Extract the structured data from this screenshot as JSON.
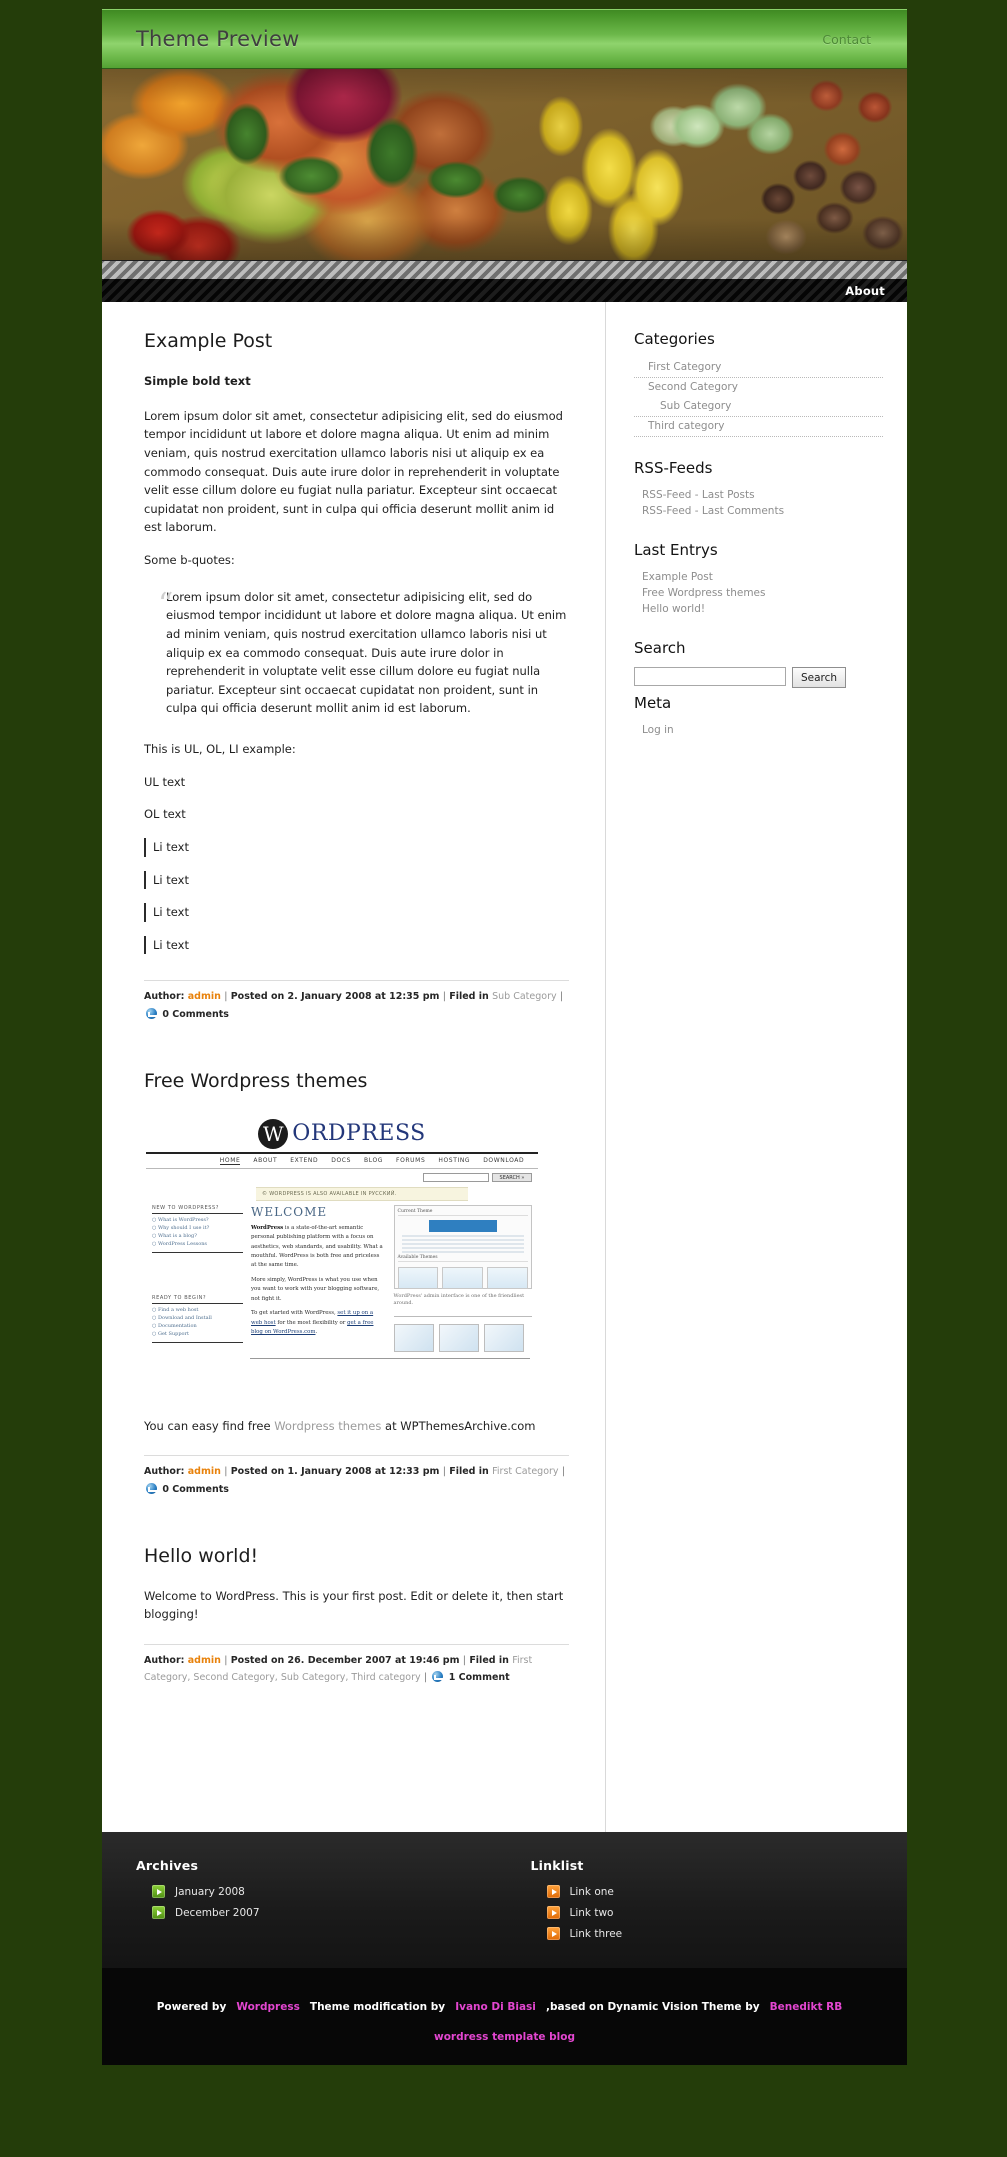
{
  "header": {
    "site_title": "Theme Preview",
    "top_nav": [
      {
        "label": "Contact"
      }
    ],
    "main_nav": [
      {
        "label": "About"
      }
    ]
  },
  "posts": [
    {
      "title": "Example Post",
      "bold_line": "Simple bold text",
      "body": "Lorem ipsum dolor sit amet, consectetur adipisicing elit, sed do eiusmod tempor incididunt ut labore et dolore magna aliqua. Ut enim ad minim veniam, quis nostrud exercitation ullamco laboris nisi ut aliquip ex ea commodo consequat. Duis aute irure dolor in reprehenderit in voluptate velit esse cillum dolore eu fugiat nulla pariatur. Excepteur sint occaecat cupidatat non proident, sunt in culpa qui officia deserunt mollit anim id est laborum.",
      "quote_intro": "Some b-quotes:",
      "quote_mark": "“",
      "quote": "Lorem ipsum dolor sit amet, consectetur adipisicing elit, sed do eiusmod tempor incididunt ut labore et dolore magna aliqua. Ut enim ad minim veniam, quis nostrud exercitation ullamco laboris nisi ut aliquip ex ea commodo consequat. Duis aute irure dolor in reprehenderit in voluptate velit esse cillum dolore eu fugiat nulla pariatur. Excepteur sint occaecat cupidatat non proident, sunt in culpa qui officia deserunt mollit anim id est laborum.",
      "list_intro": "This is UL, OL, LI example:",
      "ul_text": "UL text",
      "ol_text": "OL text",
      "li_items": [
        "Li text",
        "Li text",
        "Li text",
        "Li text"
      ],
      "meta": {
        "author_label": "Author:",
        "author": "admin",
        "posted": "Posted on 2. January 2008 at 12:35 pm",
        "filed_label": "Filed in",
        "categories": "Sub Category",
        "comments": "0 Comments"
      }
    },
    {
      "title": "Free Wordpress themes",
      "caption_pre": "You can easy find free ",
      "caption_link": "Wordpress themes",
      "caption_post": " at WPThemesArchive.com",
      "meta": {
        "author_label": "Author:",
        "author": "admin",
        "posted": "Posted on 1. January 2008 at 12:33 pm",
        "filed_label": "Filed in",
        "categories": "First Category",
        "comments": "0 Comments"
      }
    },
    {
      "title": "Hello world!",
      "body": "Welcome to WordPress. This is your first post. Edit or delete it, then start blogging!",
      "meta": {
        "author_label": "Author:",
        "author": "admin",
        "posted": "Posted on 26. December 2007 at 19:46 pm",
        "filed_label": "Filed in",
        "categories": "First Category, Second Category, Sub Category, Third category",
        "comments": "1 Comment"
      }
    }
  ],
  "wp_screenshot": {
    "brand_mark": "W",
    "brand_word": "ORDPRESS",
    "nav": [
      "HOME",
      "ABOUT",
      "EXTEND",
      "DOCS",
      "BLOG",
      "FORUMS",
      "HOSTING",
      "DOWNLOAD"
    ],
    "search_button": "SEARCH »",
    "notice": "© WORDPRESS IS ALSO AVAILABLE IN РУССКИЙ.",
    "col1_head_a": "NEW TO WORDPRESS?",
    "col1_links_a": [
      "○ What is WordPress?",
      "○ Why should I use it?",
      "○ What is a blog?",
      "○ WordPress Lessons"
    ],
    "col1_head_b": "READY TO BEGIN?",
    "col1_links_b": [
      "○ Find a web host",
      "○ Download and Install",
      "○ Documentation",
      "○ Get Support"
    ],
    "welcome": "WELCOME",
    "para1_lead": "WordPress",
    "para1": " is a state-of-the-art semantic personal publishing platform with a focus on aesthetics, web standards, and usability. What a mouthful. WordPress is both free and priceless at the same time.",
    "para2": "More simply, WordPress is what you use when you want to work with your blogging software, not fight it.",
    "para3_pre": "To get started with WordPress, ",
    "para3_link1": "set it up on a web host",
    "para3_mid": " for the most flexibility or ",
    "para3_link2": "get a free blog on WordPress.com",
    "para3_end": ".",
    "panel_title": "Current Theme",
    "panel_sub": "Available Themes",
    "panel_caption": "WordPress' admin interface is one of the friendliest around."
  },
  "sidebar": {
    "categories": {
      "heading": "Categories",
      "items": [
        {
          "label": "First Category",
          "children": []
        },
        {
          "label": "Second Category",
          "children": [
            {
              "label": "Sub Category"
            }
          ]
        },
        {
          "label": "Third category",
          "children": []
        }
      ]
    },
    "rss": {
      "heading": "RSS-Feeds",
      "items": [
        {
          "label": "RSS-Feed - Last Posts"
        },
        {
          "label": "RSS-Feed - Last Comments"
        }
      ]
    },
    "last_entries": {
      "heading": "Last Entrys",
      "items": [
        {
          "label": "Example Post"
        },
        {
          "label": "Free Wordpress themes"
        },
        {
          "label": "Hello world!"
        }
      ]
    },
    "search": {
      "heading": "Search",
      "value": "",
      "placeholder": "",
      "button": "Search"
    },
    "meta": {
      "heading": "Meta",
      "items": [
        {
          "label": "Log in"
        }
      ]
    }
  },
  "footer": {
    "archives": {
      "heading": "Archives",
      "items": [
        {
          "label": "January 2008"
        },
        {
          "label": "December 2007"
        }
      ]
    },
    "linklist": {
      "heading": "Linklist",
      "items": [
        {
          "label": "Link one"
        },
        {
          "label": "Link two"
        },
        {
          "label": "Link three"
        }
      ]
    },
    "credits": {
      "powered_by": "Powered by",
      "wordpress": "Wordpress",
      "modification": "Theme modification by",
      "modifier": "Ivano Di Biasi",
      "based_on": ",based on Dynamic Vision Theme by",
      "author": "Benedikt RB",
      "template_blog": "wordress template blog"
    }
  },
  "colors": {
    "header_green": "#6cb84a",
    "page_background": "#243d0a",
    "author_orange": "#e8820c",
    "credit_pink": "#e346d0",
    "muted_text": "#8d8d8d"
  }
}
